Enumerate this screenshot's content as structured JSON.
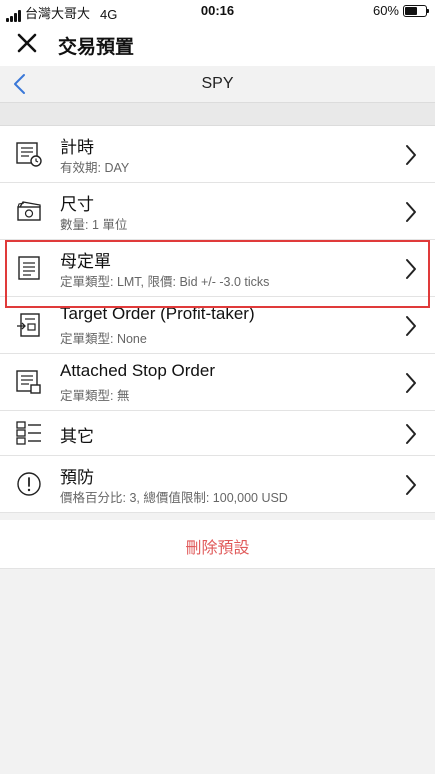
{
  "status_bar": {
    "carrier": "台灣大哥大",
    "network": "4G",
    "time": "00:16",
    "battery": "60%",
    "battery_level": 0.6
  },
  "header": {
    "title": "交易預置",
    "close_icon": "close-icon"
  },
  "nav": {
    "title": "SPY",
    "back_icon": "chevron-left-icon"
  },
  "rows": [
    {
      "title": "計時",
      "subtitle": "有效期: DAY",
      "icon": "timer-list-icon"
    },
    {
      "title": "尺寸",
      "subtitle": "數量: 1 單位",
      "icon": "money-stack-icon"
    },
    {
      "title": "母定單",
      "subtitle": "定單類型: LMT, 限價: Bid +/- -3.0 ticks",
      "icon": "order-list-icon"
    },
    {
      "title": "Target Order (Profit-taker)",
      "subtitle": "定單類型: None",
      "icon": "target-order-icon"
    },
    {
      "title": "Attached Stop Order",
      "subtitle": "定單類型: 無",
      "icon": "attached-order-icon"
    },
    {
      "title": "其它",
      "subtitle": "",
      "icon": "misc-icon"
    },
    {
      "title": "預防",
      "subtitle": "價格百分比: 3, 總價值限制: 100,000 USD",
      "icon": "info-circle-icon"
    }
  ],
  "delete_label": "刪除預設",
  "colors": {
    "accent": "#3a78d8",
    "delete": "#e05a5a",
    "highlight_border": "#e03a3a"
  }
}
